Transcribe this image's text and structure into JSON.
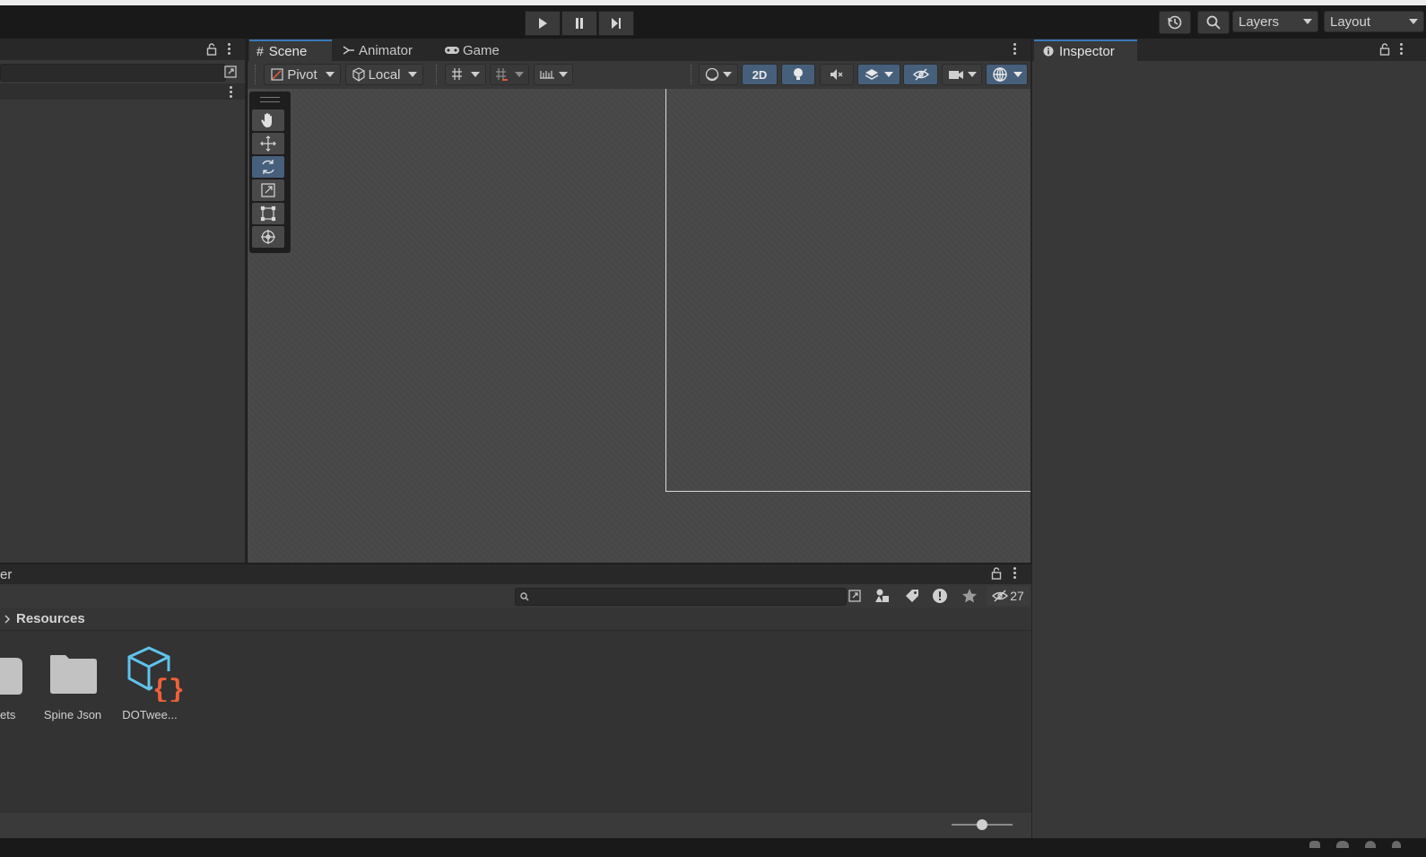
{
  "toolbar": {
    "layers_label": "Layers",
    "layout_label": "Layout",
    "icons": [
      "play-icon",
      "pause-icon",
      "step-icon",
      "history-icon",
      "search-icon"
    ]
  },
  "scene": {
    "tabs": [
      {
        "label": "Scene",
        "icon": "grid-hash-icon",
        "active": true
      },
      {
        "label": "Animator",
        "icon": "animator-icon",
        "active": false
      },
      {
        "label": "Game",
        "icon": "gamepad-icon",
        "active": false
      }
    ],
    "pivot_label": "Pivot",
    "local_label": "Local",
    "mode_2d_label": "2D",
    "tools": [
      "hand-tool",
      "move-tool",
      "rotate-tool",
      "scale-tool",
      "rect-tool",
      "transform-tool"
    ],
    "selected_tool": "rotate-tool"
  },
  "inspector": {
    "tab_label": "Inspector"
  },
  "project": {
    "tab_label_fragment": "er",
    "breadcrumb": "Resources",
    "hidden_count": "27",
    "assets": [
      {
        "label": "ets",
        "icon": "folder-icon"
      },
      {
        "label": "Spine Json",
        "icon": "folder-icon"
      },
      {
        "label": "DOTwee...",
        "icon": "script-asset-icon"
      }
    ]
  },
  "colors": {
    "accent_blue": "#3a79bb",
    "selected_tool": "#46607c",
    "panel": "#383838",
    "scene_bg": "#474747"
  }
}
